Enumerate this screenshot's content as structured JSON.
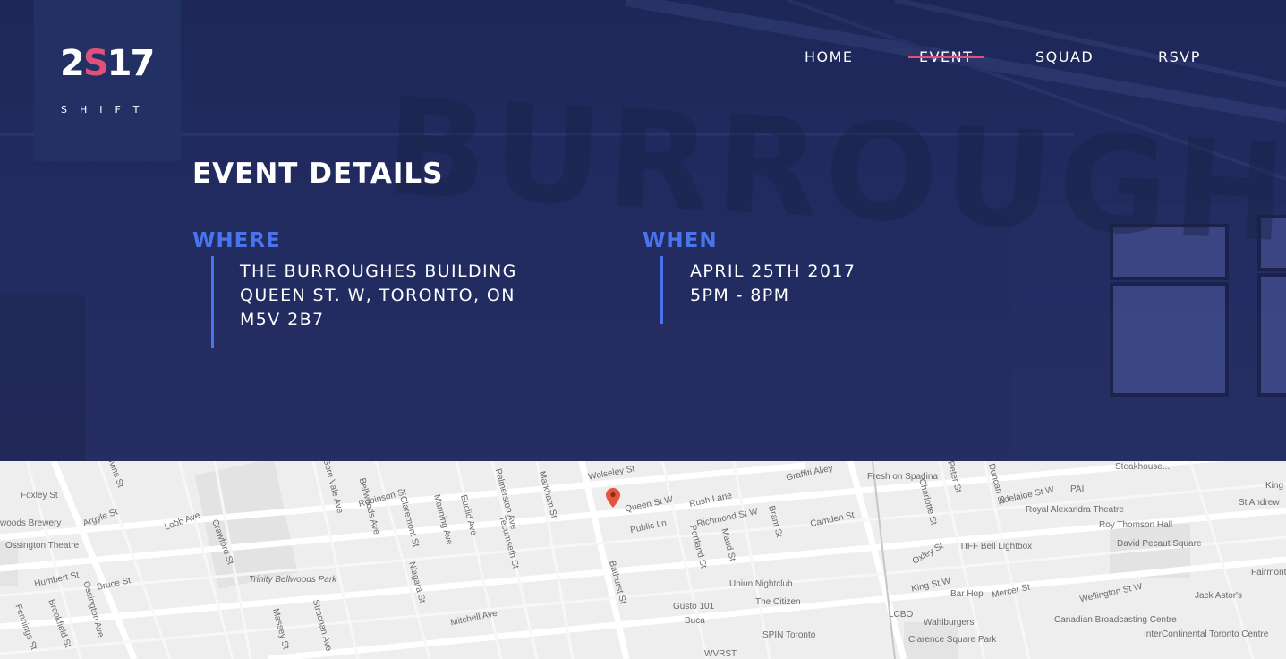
{
  "logo": {
    "num_left": "2",
    "num_accent": "S",
    "num_right": "17",
    "sub": "SHIFT"
  },
  "nav": {
    "items": [
      {
        "label": "HOME"
      },
      {
        "label": "EVENT",
        "active": true
      },
      {
        "label": "SQUAD"
      },
      {
        "label": "RSVP"
      }
    ]
  },
  "hero": {
    "title": "EVENT DETAILS",
    "where": {
      "heading": "WHERE",
      "lines": [
        "THE BURROUGHES BUILDING",
        "QUEEN ST. W, TORONTO, ON",
        "M5V 2B7"
      ]
    },
    "when": {
      "heading": "WHEN",
      "lines": [
        "APRIL 25TH 2017",
        "5PM - 8PM"
      ]
    },
    "background_wall_text": "BURROUGHES"
  },
  "colors": {
    "accent_blue": "#4a73ee",
    "accent_pink": "#e0507a",
    "navy": "#223064"
  },
  "map": {
    "labels": [
      "Foxley St",
      "Argyle St",
      "Givins St",
      "Lobb Ave",
      "Crawford St",
      "Robinson St",
      "Claremont St",
      "Manning Ave",
      "Euclid Ave",
      "Palmerston Ave",
      "Markham St",
      "Wolseley St",
      "Queen St W",
      "Public Ln",
      "Rush Lane",
      "Richmond St W",
      "Graffiti Alley",
      "Fresh on Spadina",
      "Peter St",
      "Adelaide St W",
      "Camden St",
      "Portland St",
      "Maud St",
      "Brant St",
      "Steakhouse...",
      "PAI",
      "Royal Alexandra Theatre",
      "Roy Thomson Hall",
      "St Andrew",
      "King St W",
      "TIFF Bell Lightbox",
      "David Pecaut Square",
      "Wellington St W",
      "Jack Astor's",
      "Fairmont",
      "Canadian Broadcasting Centre",
      "InterContinental Toronto Centre",
      "Clarence Square Park",
      "Wahlburgers",
      "Bar Hop",
      "Mercer St",
      "Oxley St",
      "Uniun Nightclub",
      "The Citizen",
      "Gusto 101",
      "Buca",
      "SPIN Toronto",
      "WVRST",
      "Bathurst St",
      "Tecumseth St",
      "Niagara St",
      "Mitchell Ave",
      "Strachan Ave",
      "Massey St",
      "Trinity Bellwoods Park",
      "Gore Vale Ave",
      "Bellwoods Ave",
      "Humbert St",
      "Bruce St",
      "Ossington Ave",
      "Fennings St",
      "Brookfield St",
      "Ossington Theatre",
      "woods Brewery",
      "LCBO",
      "Charlotte St",
      "Duncan St",
      "King"
    ]
  }
}
